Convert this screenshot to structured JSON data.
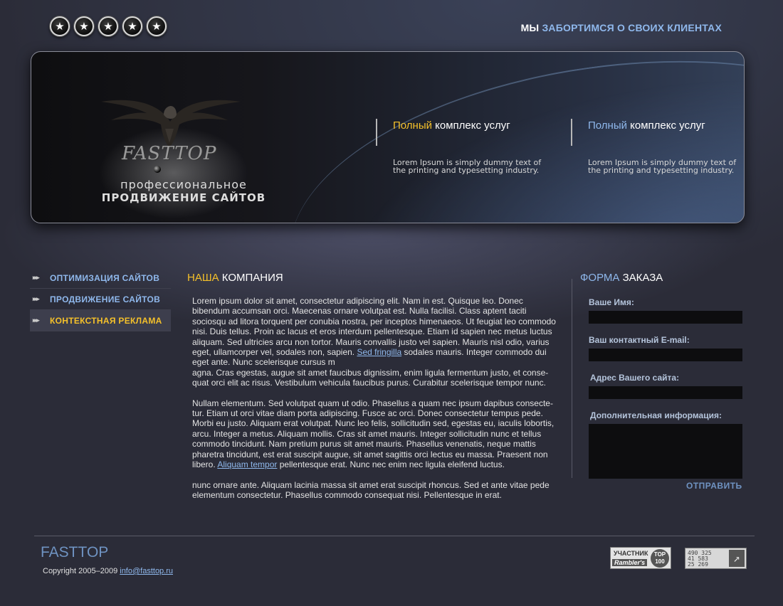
{
  "header": {
    "stars": [
      "★",
      "★",
      "★",
      "★",
      "★"
    ],
    "slogan_white": "МЫ",
    "slogan_blue": "ЗАБОРТИМСЯ О СВОИХ КЛИЕНТАХ"
  },
  "banner": {
    "brand": "FASTTOP",
    "tagline1": "профессиональное",
    "tagline2": "ПРОДВИЖЕНИЕ САЙТОВ",
    "services": [
      {
        "highlight": "Полный",
        "rest": " комплекс услуг",
        "text": "Lorem Ipsum is simply dummy text of the printing and typesetting industry."
      },
      {
        "highlight": "Полный",
        "rest": " комплекс услуг",
        "text": "Lorem Ipsum is simply dummy text  of the printing and typesetting industry."
      }
    ]
  },
  "menu": {
    "items": [
      {
        "label": "ОПТИМИЗАЦИЯ САЙТОВ",
        "active": false
      },
      {
        "label": "ПРОДВИЖЕНИЕ САЙТОВ",
        "active": false
      },
      {
        "label": "КОНТЕКСТНАЯ РЕКЛАМА",
        "active": true
      }
    ]
  },
  "company": {
    "title_highlight": "НАША",
    "title_rest": " КОМПАНИЯ",
    "p1_before": "Lorem ipsum dolor sit amet, consectetur adipiscing elit. Nam in est. Quisque leo. Donec bibendum accumsan orci. Maecenas ornare volutpat est. Nulla facilisi. Class aptent taciti sociosqu ad litora torquent per conubia nostra, per inceptos himenaeos. Ut feugiat leo commodo nisi. Duis tellus. Proin ac lacus et eros interdum pellentesque. Etiam id sapien nec metus luctus aliquam. Sed ultricies arcu non tortor. Mauris convallis justo vel sapien. Mauris nisl odio, varius eget, ullamcorper vel, sodales non, sapien. ",
    "p1_link": "Sed fringilla",
    "p1_after": " sodales mauris. Integer commodo dui eget ante. Nunc scelerisque cursus m",
    "p1_cont": "agna. Cras egestas, augue sit amet faucibus dignissim, enim ligula fermentum justo, et conse-quat orci elit ac risus. Vestibulum vehicula faucibus purus. Curabitur scelerisque tempor nunc.",
    "p2_before": "Nullam elementum. Sed volutpat quam ut odio. Phasellus a quam nec ipsum dapibus consecte-tur. Etiam ut orci vitae diam porta adipiscing. Fusce ac orci. Donec consectetur tempus pede. Morbi eu justo. Aliquam erat volutpat. Nunc leo felis, sollicitudin sed, egestas eu, iaculis lobortis, arcu. Integer a metus. Aliquam mollis. Cras sit amet mauris. Integer sollicitudin nunc et tellus commodo tincidunt. Nam pretium purus sit amet mauris. Phasellus venenatis, neque mattis pharetra tincidunt, est erat suscipit augue, sit amet sagittis orci lectus eu massa. Praesent non libero. ",
    "p2_link": "Aliquam tempor",
    "p2_after": " pellentesque erat. Nunc nec enim nec ligula eleifend luctus.",
    "p3": "nunc ornare ante. Aliquam lacinia massa sit amet erat suscipit rhoncus. Sed et ante vitae pede elementum consectetur. Phasellus commodo consequat nisi. Pellentesque in erat."
  },
  "order_form": {
    "title_highlight": "ФОРМА",
    "title_rest": " ЗАКАЗА",
    "name_label": "Ваше Имя:",
    "name_value": "",
    "email_label": "Ваш контактный E-mail:",
    "email_value": "",
    "site_label": "Адрес Вашего сайта:",
    "site_value": "",
    "info_label": "Дополнительная информация:",
    "info_value": "",
    "submit": "ОТПРАВИТЬ"
  },
  "footer": {
    "brand": "FASTTOP",
    "copyright": "Copyright 2005–2009 ",
    "email": "info@fasttop.ru",
    "badge_rambler_top": "УЧАСТНИК",
    "badge_rambler_bottom": "Rambler's",
    "badge_rambler_circle": "TOP 100",
    "counter_lines": [
      "490 325",
      "41 583",
      "25 269"
    ],
    "counter_arrow": "↗"
  },
  "colors": {
    "accent_yellow": "#f4c02a",
    "accent_blue": "#8fb8ec",
    "background": "#2b2c38"
  }
}
